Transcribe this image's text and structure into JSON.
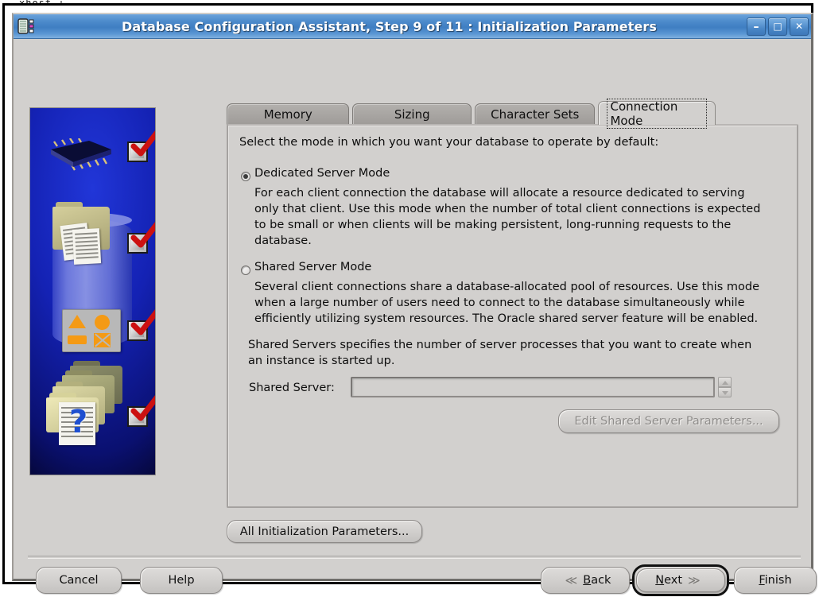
{
  "terminal_line": "xhost +",
  "window": {
    "title": "Database Configuration Assistant, Step 9 of 11 : Initialization Parameters",
    "app_icon": "database-chip-icon",
    "controls": {
      "minimize": "–",
      "maximize": "□",
      "close": "✕"
    }
  },
  "banner": {
    "alt": "oracle-installer-banner",
    "checkmarks": 4
  },
  "tabs": [
    {
      "label": "Memory",
      "selected": false
    },
    {
      "label": "Sizing",
      "selected": false
    },
    {
      "label": "Character Sets",
      "selected": false
    },
    {
      "label": "Connection Mode",
      "selected": true
    }
  ],
  "panel": {
    "intro": "Select the mode in which you want your database to operate by default:",
    "dedicated": {
      "label": "Dedicated Server Mode",
      "selected": true,
      "description_lines": [
        "For each client connection the database will allocate a resource dedicated to serving",
        "only that client.  Use this mode when the number of total client connections is expected",
        "to be small or when clients will be making persistent, long-running requests to the",
        "database."
      ]
    },
    "shared": {
      "label": "Shared Server Mode",
      "selected": false,
      "description_lines": [
        "Several client connections share a database-allocated pool of resources.  Use this mode",
        "when a large number of users need to connect to the database simultaneously while",
        "efficiently utilizing system resources.  The Oracle shared server feature will be enabled."
      ],
      "note_lines": [
        "Shared Servers specifies the number of server processes that you want to create when",
        "an instance is started up."
      ],
      "field_label": "Shared Server:",
      "field_value": "",
      "field_placeholder": "",
      "field_enabled": false,
      "spinner": {
        "up": "spinner-up-arrow",
        "down": "spinner-down-arrow",
        "enabled": false
      },
      "edit_button": {
        "label": "Edit Shared Server Parameters...",
        "enabled": false
      }
    }
  },
  "all_params_button": "All Initialization Parameters...",
  "nav": {
    "cancel": "Cancel",
    "help": "Help",
    "back": {
      "label": "Back",
      "mnemonic": "B",
      "chevron": "≪"
    },
    "next": {
      "label": "Next",
      "mnemonic": "N",
      "chevron": "≫",
      "focused": true
    },
    "finish": {
      "label": "Finish",
      "mnemonic": "F"
    }
  },
  "colors": {
    "titlebar_blue": "#4e8ccc",
    "window_face": "#d2d0ce",
    "tab_unselected": "#9e9b98",
    "banner_blue": "#1422b4",
    "checkmark_red": "#cc1111",
    "accent_orange": "#f49a15"
  }
}
